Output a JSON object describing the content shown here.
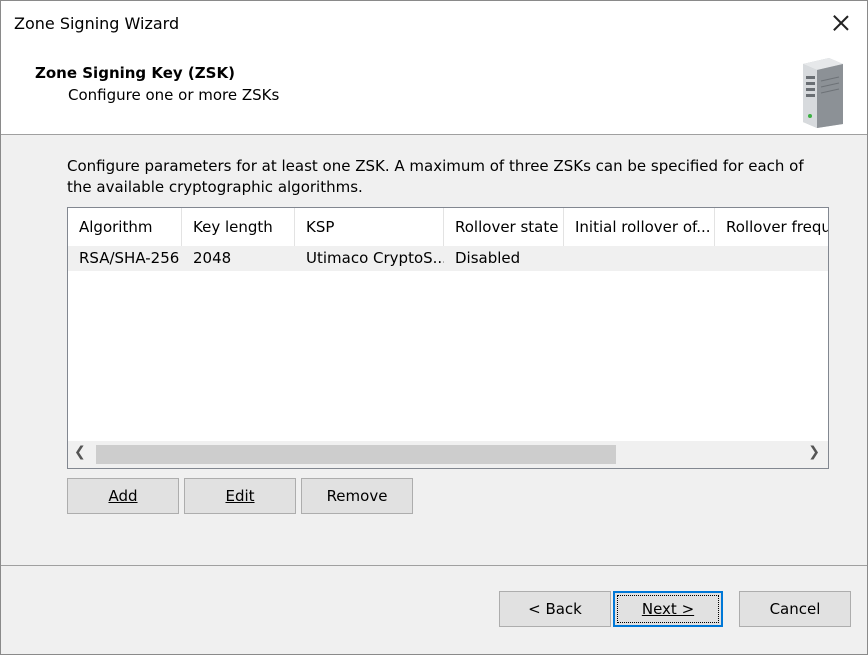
{
  "window": {
    "title": "Zone Signing Wizard",
    "close_icon": "close-icon"
  },
  "header": {
    "title": "Zone Signing Key (ZSK)",
    "subtitle": "Configure one or more ZSKs",
    "icon": "server-tower-icon"
  },
  "content": {
    "description": "Configure parameters for at least one ZSK. A maximum of three ZSKs can be specified for each of the available cryptographic algorithms.",
    "table": {
      "columns": [
        "Algorithm",
        "Key length",
        "KSP",
        "Rollover state",
        "Initial rollover of...",
        "Rollover frequ"
      ],
      "rows": [
        [
          "RSA/SHA-256",
          "2048",
          "Utimaco CryptoS...",
          "Disabled",
          "",
          ""
        ]
      ]
    },
    "buttons": {
      "add": "Add",
      "edit": "Edit",
      "remove": "Remove"
    }
  },
  "footer": {
    "back": "< Back",
    "next": "Next >",
    "cancel": "Cancel"
  },
  "colors": {
    "focus_border": "#0078d7",
    "panel_bg": "#f0f0f0",
    "button_bg": "#e1e1e1"
  }
}
